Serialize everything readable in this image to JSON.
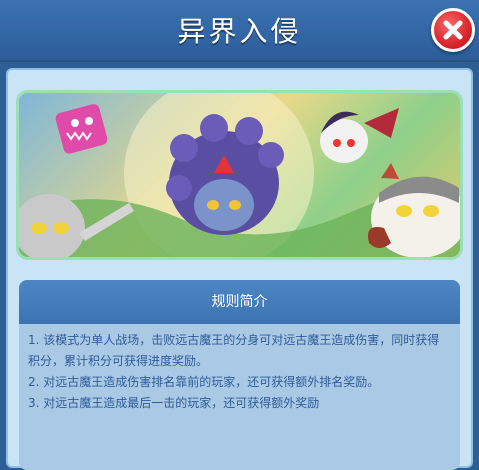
{
  "header": {
    "title": "异界入侵"
  },
  "close_button": {
    "icon": "close-icon",
    "color": "#d8262c"
  },
  "banner": {
    "description_icon": "demon-king-banner-image"
  },
  "rules": {
    "heading": "规则简介",
    "items": [
      "1. 该模式为单人战场，击败远古魔王的分身可对远古魔王造成伤害，同时获得积分，累计积分可获得进度奖励。",
      "2. 对远古魔王造成伤害排名靠前的玩家，还可获得额外排名奖励。",
      "3. 对远古魔王造成最后一击的玩家，还可获得额外奖励"
    ]
  },
  "colors": {
    "title_bar": "#3b72b2",
    "panel": "#c8e4f6",
    "rules_text": "#2f5b9a",
    "rules_header": "#4e86c4"
  }
}
